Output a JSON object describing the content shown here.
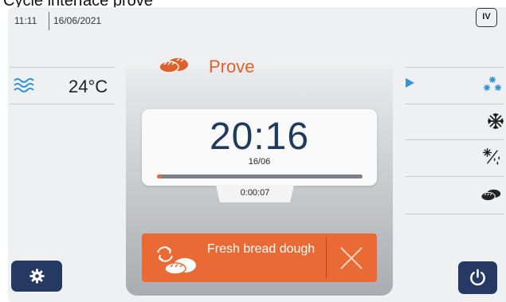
{
  "caption": "Cycle interface prove",
  "topbar": {
    "time": "11:11",
    "date": "16/06/2021",
    "badge": "IV"
  },
  "left_panel": {
    "icon": "steam-waves-icon",
    "temperature": "24°C"
  },
  "center_panel": {
    "mode_icon": "bread-icon",
    "mode_title": "Prove",
    "clock_time": "20:16",
    "clock_date": "16/06",
    "progress_fraction": 0.02,
    "elapsed": "0:00:07",
    "program_label": "Fresh bread dough",
    "program_icon": "bread-cycle-icon",
    "cancel_icon": "close-icon"
  },
  "right_panel": {
    "items": [
      {
        "icon": "snowflake-cluster-icon",
        "active": true
      },
      {
        "icon": "snowflake-icon",
        "active": false
      },
      {
        "icon": "snowflake-drops-icon",
        "active": false
      },
      {
        "icon": "bread-icon",
        "active": false
      }
    ]
  },
  "bottom": {
    "settings_icon": "gear-icon",
    "power_icon": "power-icon"
  },
  "colors": {
    "accent": "#e96a35",
    "navy": "#243a63",
    "blue": "#2f95d4",
    "clock": "#1f3a5a"
  }
}
